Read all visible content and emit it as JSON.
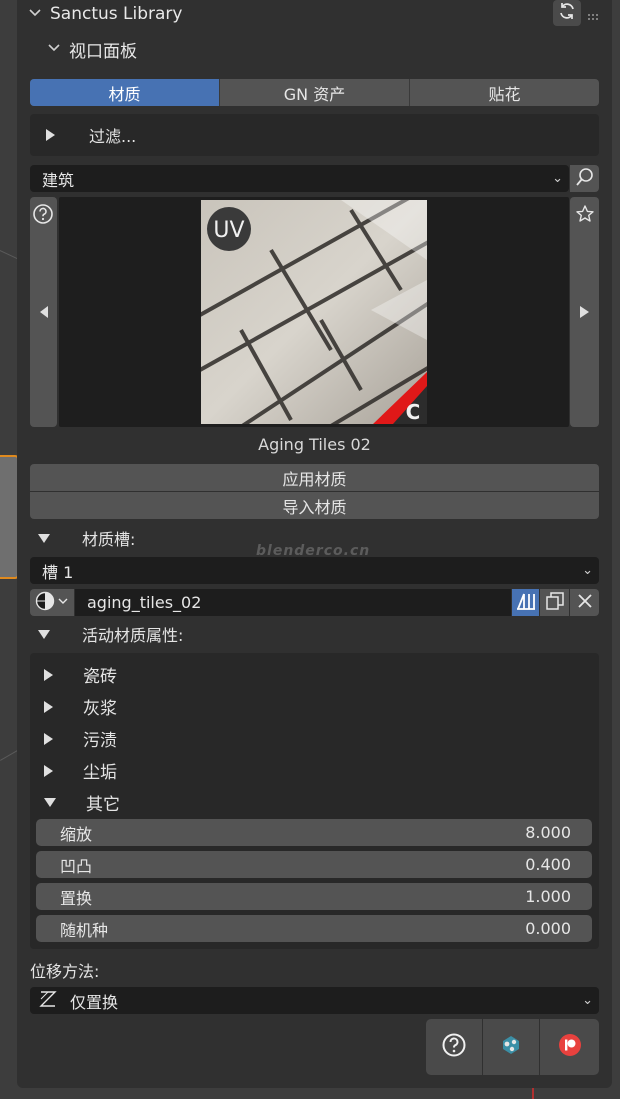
{
  "header": {
    "title": "Sanctus Library",
    "subheader": "视口面板"
  },
  "tabs": [
    {
      "label": "材质",
      "active": true
    },
    {
      "label": "GN 资产",
      "active": false
    },
    {
      "label": "贴花",
      "active": false
    }
  ],
  "filter": {
    "label": "过滤..."
  },
  "category": {
    "value": "建筑"
  },
  "preview": {
    "material_name": "Aging Tiles 02",
    "badge_uv": "UV",
    "badge_c": "C"
  },
  "actions": {
    "apply": "应用材质",
    "import": "导入材质"
  },
  "slots": {
    "label": "材质槽:",
    "slot_value": "槽 1",
    "material_value": "aging_tiles_02"
  },
  "watermark": "blenderco.cn",
  "properties": {
    "label": "活动材质属性:",
    "categories": [
      {
        "label": "瓷砖",
        "expanded": false
      },
      {
        "label": "灰浆",
        "expanded": false
      },
      {
        "label": "污渍",
        "expanded": false
      },
      {
        "label": "尘垢",
        "expanded": false
      },
      {
        "label": "其它",
        "expanded": true
      }
    ],
    "fields": [
      {
        "label": "缩放",
        "value": "8.000"
      },
      {
        "label": "凹凸",
        "value": "0.400"
      },
      {
        "label": "置换",
        "value": "1.000"
      },
      {
        "label": "随机种",
        "value": "0.000"
      }
    ]
  },
  "displacement": {
    "label": "位移方法:",
    "value": "仅置换"
  },
  "colors": {
    "accent": "#4772b3",
    "panel": "#303030",
    "button": "#545454",
    "field": "#1d1d1d"
  }
}
